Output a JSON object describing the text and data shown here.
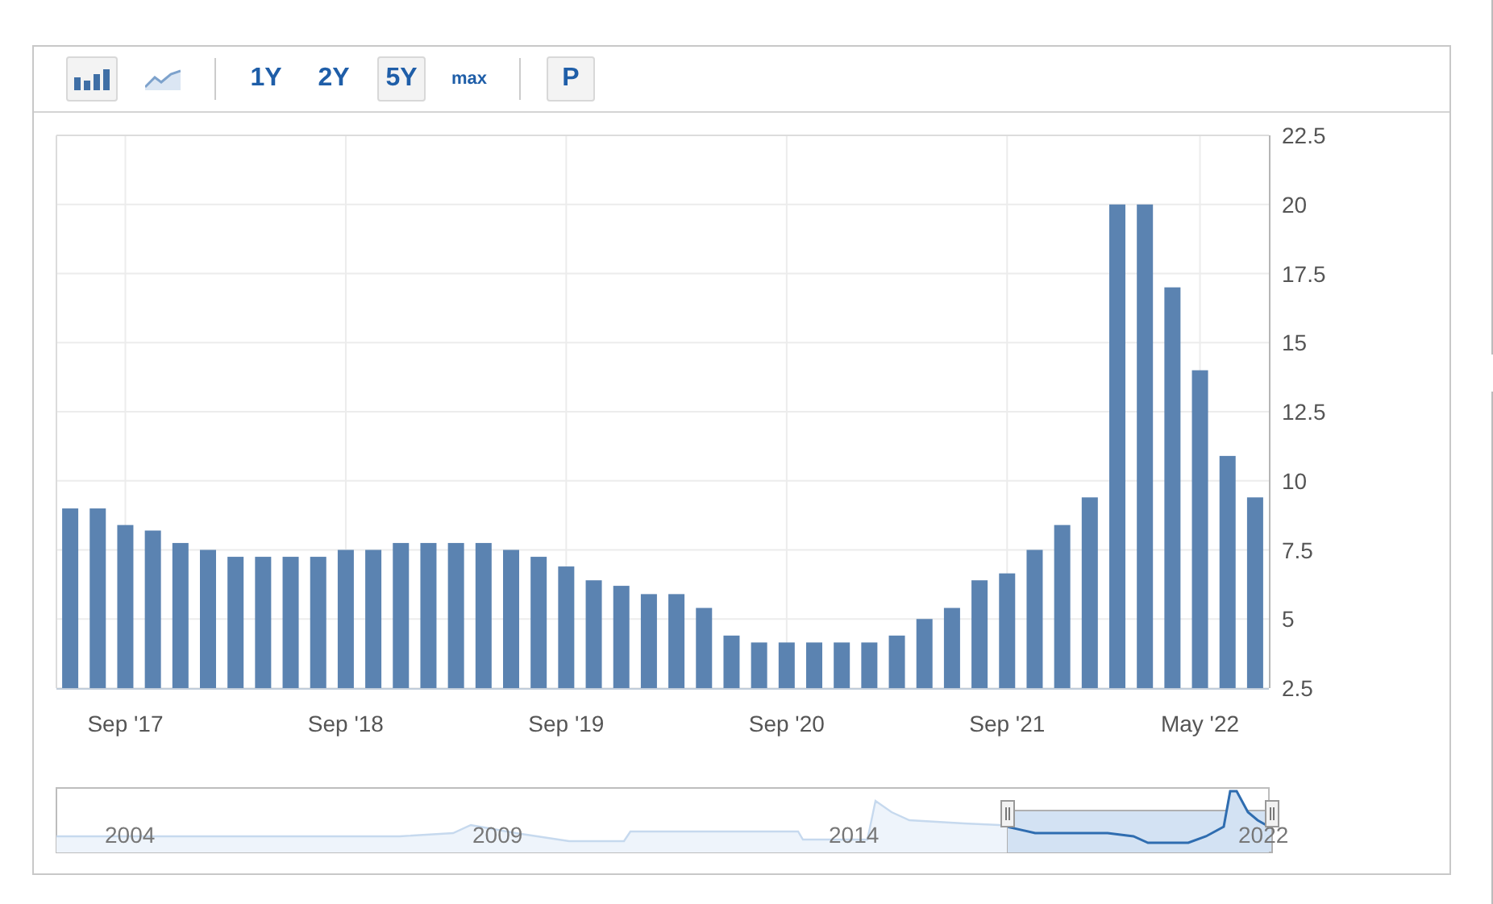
{
  "toolbar": {
    "chart_types": [
      {
        "kind": "bar",
        "selected": true
      },
      {
        "kind": "line",
        "selected": false
      }
    ],
    "ranges": [
      {
        "label": "1Y",
        "kind": "period",
        "selected": false
      },
      {
        "label": "2Y",
        "kind": "period",
        "selected": false
      },
      {
        "label": "5Y",
        "kind": "period",
        "selected": true
      },
      {
        "label": "max",
        "kind": "all",
        "selected": false
      }
    ],
    "p_button": {
      "label": "P"
    }
  },
  "chart": {
    "chart_data": {
      "type": "bar",
      "values": [
        9.0,
        9.0,
        8.4,
        8.2,
        7.75,
        7.5,
        7.25,
        7.25,
        7.25,
        7.25,
        7.5,
        7.5,
        7.75,
        7.75,
        7.75,
        7.75,
        7.5,
        7.25,
        6.9,
        6.4,
        6.2,
        5.9,
        5.9,
        5.4,
        4.4,
        4.15,
        4.15,
        4.15,
        4.15,
        4.15,
        4.4,
        5.0,
        5.4,
        6.4,
        6.65,
        7.5,
        8.4,
        9.4,
        20,
        20,
        17,
        14,
        10.9,
        9.4
      ],
      "categories": [
        null,
        null,
        "Sep '17",
        null,
        null,
        null,
        null,
        null,
        null,
        null,
        "Sep '18",
        null,
        null,
        null,
        null,
        null,
        null,
        null,
        "Sep '19",
        null,
        null,
        null,
        null,
        null,
        null,
        null,
        "Sep '20",
        null,
        null,
        null,
        null,
        null,
        null,
        null,
        "Sep '21",
        null,
        null,
        null,
        null,
        null,
        null,
        "May '22",
        null,
        null
      ],
      "grid": true,
      "ylim": [
        2.5,
        22.5
      ],
      "yticks": [
        2.5,
        5,
        7.5,
        10,
        12.5,
        15,
        17.5,
        20,
        22.5
      ]
    }
  },
  "navigator": {
    "years": [
      "2004",
      "2009",
      "2014",
      "2022"
    ]
  }
}
